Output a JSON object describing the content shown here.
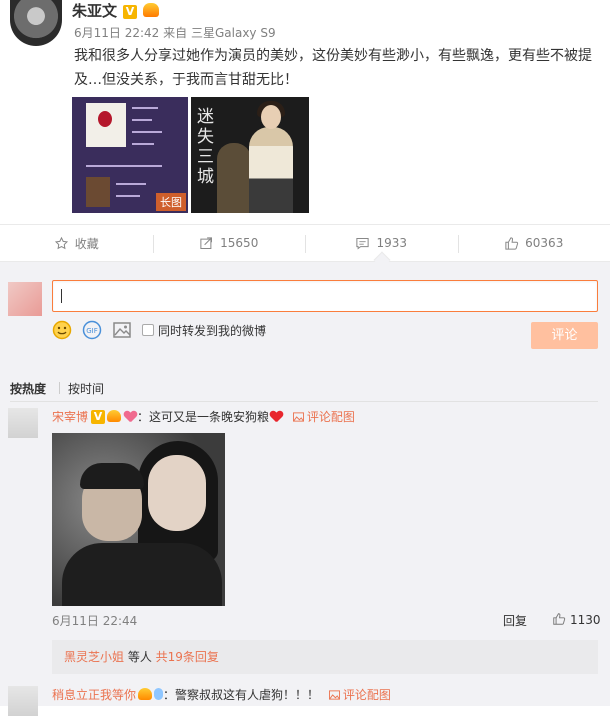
{
  "post": {
    "author": "朱亚文",
    "verified_badge": "V",
    "time": "6月11日 22:42",
    "source_prefix": "来自",
    "device": "三星Galaxy S9",
    "text": "我和很多人分享过她作为演员的美妙，这份美妙有些渺小，有些飘逸，更有些不被提及…但没关系，于我而言甘甜无比！",
    "image_tag": "长图",
    "movie_title": "迷 失 三 城"
  },
  "actions": {
    "favorite_label": "收藏",
    "repost_count": "15650",
    "comment_count": "1933",
    "like_count": "60363"
  },
  "comment_box": {
    "forward_label": "同时转发到我的微博",
    "submit_label": "评论"
  },
  "sort": {
    "hot_label": "按热度",
    "time_label": "按时间"
  },
  "comments": [
    {
      "user": "宋宰博",
      "badge": "V",
      "text": "：这可又是一条晚安狗粮",
      "pic_link": "评论配图",
      "time": "6月11日 22:44",
      "reply_label": "回复",
      "likes": "1130",
      "sub_user": "黑灵芝小姐",
      "sub_mid": " 等人 ",
      "sub_count": "共19条回复"
    },
    {
      "user": "稍息立正我等你",
      "text": "：警察叔叔这有人虐狗！！！",
      "pic_link": "评论配图"
    }
  ],
  "colors": {
    "accent": "#eb7350",
    "input_border": "#fa7d3c",
    "submit_bg": "#ffc09f",
    "panel_bg": "#f2f2f5"
  }
}
